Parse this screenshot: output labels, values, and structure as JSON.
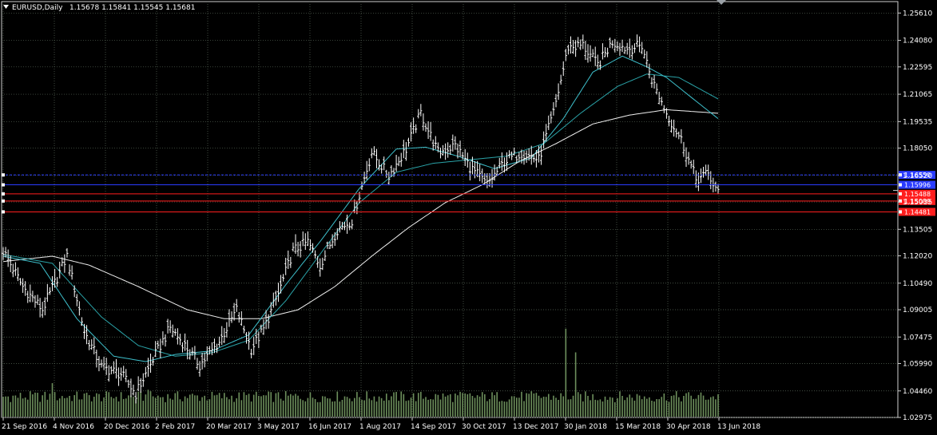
{
  "header": {
    "collapse_icon": "triangle-down-icon",
    "symbol": "EURUSD,Daily",
    "ohlc": "1.15678 1.15841 1.15545 1.15681"
  },
  "colors": {
    "background": "#000000",
    "grid": "#5a6a5a",
    "bars": "#ffffff",
    "ma_fast": "#3ec0cc",
    "ma_mid": "#2aa3a8",
    "ma_slow": "#f0f0f0",
    "volume": "#6d8f5c",
    "level_blue": "#2a3cff",
    "level_red": "#ff1e1e"
  },
  "chart_data": {
    "type": "candlestick",
    "symbol": "EURUSD",
    "timeframe": "Daily",
    "x_tick_labels": [
      "21 Sep 2016",
      "4 Nov 2016",
      "20 Dec 2016",
      "2 Feb 2017",
      "20 Mar 2017",
      "3 May 2017",
      "16 Jun 2017",
      "1 Aug 2017",
      "14 Sep 2017",
      "30 Oct 2017",
      "13 Dec 2017",
      "30 Jan 2018",
      "15 Mar 2018",
      "30 Apr 2018",
      "13 Jun 2018"
    ],
    "y_tick_labels": [
      "1.25610",
      "1.24080",
      "1.22595",
      "1.21065",
      "1.19535",
      "1.18050",
      "1.16520",
      "1.15035",
      "1.13505",
      "1.12020",
      "1.10490",
      "1.09005",
      "1.07475",
      "1.05990",
      "1.04460",
      "1.02975"
    ],
    "ylim": [
      1.02975,
      1.2625
    ],
    "price_path": [
      [
        0,
        1.123
      ],
      [
        8,
        1.103
      ],
      [
        16,
        1.09
      ],
      [
        26,
        1.12
      ],
      [
        33,
        1.078
      ],
      [
        40,
        1.058
      ],
      [
        48,
        1.054
      ],
      [
        54,
        1.043
      ],
      [
        62,
        1.065
      ],
      [
        68,
        1.08
      ],
      [
        74,
        1.07
      ],
      [
        80,
        1.059
      ],
      [
        88,
        1.072
      ],
      [
        95,
        1.09
      ],
      [
        101,
        1.068
      ],
      [
        106,
        1.079
      ],
      [
        112,
        1.099
      ],
      [
        118,
        1.123
      ],
      [
        124,
        1.128
      ],
      [
        129,
        1.115
      ],
      [
        136,
        1.135
      ],
      [
        142,
        1.14
      ],
      [
        150,
        1.178
      ],
      [
        157,
        1.165
      ],
      [
        164,
        1.18
      ],
      [
        170,
        1.2
      ],
      [
        177,
        1.178
      ],
      [
        184,
        1.182
      ],
      [
        190,
        1.17
      ],
      [
        197,
        1.16
      ],
      [
        204,
        1.173
      ],
      [
        211,
        1.178
      ],
      [
        218,
        1.174
      ],
      [
        224,
        1.2
      ],
      [
        230,
        1.237
      ],
      [
        236,
        1.238
      ],
      [
        242,
        1.227
      ],
      [
        248,
        1.24
      ],
      [
        254,
        1.236
      ],
      [
        260,
        1.238
      ],
      [
        264,
        1.219
      ],
      [
        270,
        1.2
      ],
      [
        276,
        1.185
      ],
      [
        282,
        1.163
      ],
      [
        287,
        1.166
      ],
      [
        291,
        1.155
      ]
    ],
    "ma_fast": [
      [
        0,
        1.12
      ],
      [
        15,
        1.116
      ],
      [
        30,
        1.085
      ],
      [
        45,
        1.064
      ],
      [
        58,
        1.061
      ],
      [
        70,
        1.065
      ],
      [
        85,
        1.067
      ],
      [
        100,
        1.076
      ],
      [
        115,
        1.104
      ],
      [
        130,
        1.13
      ],
      [
        145,
        1.158
      ],
      [
        160,
        1.18
      ],
      [
        172,
        1.181
      ],
      [
        185,
        1.176
      ],
      [
        200,
        1.169
      ],
      [
        215,
        1.175
      ],
      [
        228,
        1.197
      ],
      [
        240,
        1.223
      ],
      [
        252,
        1.232
      ],
      [
        262,
        1.226
      ],
      [
        270,
        1.22
      ],
      [
        280,
        1.209
      ],
      [
        291,
        1.197
      ]
    ],
    "ma_mid": [
      [
        0,
        1.121
      ],
      [
        20,
        1.116
      ],
      [
        40,
        1.086
      ],
      [
        55,
        1.07
      ],
      [
        70,
        1.064
      ],
      [
        85,
        1.066
      ],
      [
        100,
        1.073
      ],
      [
        115,
        1.095
      ],
      [
        130,
        1.123
      ],
      [
        145,
        1.15
      ],
      [
        160,
        1.167
      ],
      [
        175,
        1.172
      ],
      [
        190,
        1.174
      ],
      [
        205,
        1.176
      ],
      [
        220,
        1.183
      ],
      [
        235,
        1.2
      ],
      [
        250,
        1.215
      ],
      [
        262,
        1.222
      ],
      [
        275,
        1.22
      ],
      [
        291,
        1.208
      ]
    ],
    "ma_slow": [
      [
        0,
        1.117
      ],
      [
        20,
        1.12
      ],
      [
        35,
        1.115
      ],
      [
        55,
        1.103
      ],
      [
        75,
        1.09
      ],
      [
        90,
        1.085
      ],
      [
        105,
        1.085
      ],
      [
        120,
        1.09
      ],
      [
        135,
        1.103
      ],
      [
        150,
        1.12
      ],
      [
        165,
        1.136
      ],
      [
        180,
        1.15
      ],
      [
        195,
        1.16
      ],
      [
        210,
        1.173
      ],
      [
        225,
        1.183
      ],
      [
        240,
        1.194
      ],
      [
        255,
        1.199
      ],
      [
        270,
        1.202
      ],
      [
        291,
        1.2
      ]
    ],
    "volume_spikes": [
      [
        20,
        1.3
      ],
      [
        59,
        1.1
      ],
      [
        229,
        2.4
      ],
      [
        233,
        1.6
      ]
    ],
    "horizontal_levels": [
      {
        "price": 1.1655,
        "label": "1.16550",
        "color": "blue",
        "style": "dashed"
      },
      {
        "price": 1.15996,
        "label": "1.15996",
        "color": "blue",
        "style": "solid"
      },
      {
        "price": 1.15488,
        "label": "1.15488",
        "color": "red",
        "style": "solid"
      },
      {
        "price": 1.15089,
        "label": "1.15089",
        "color": "red",
        "style": "solid"
      },
      {
        "price": 1.14481,
        "label": "1.14481",
        "color": "red",
        "style": "solid"
      }
    ],
    "current_price_marker": 1.15681,
    "grid": true
  }
}
